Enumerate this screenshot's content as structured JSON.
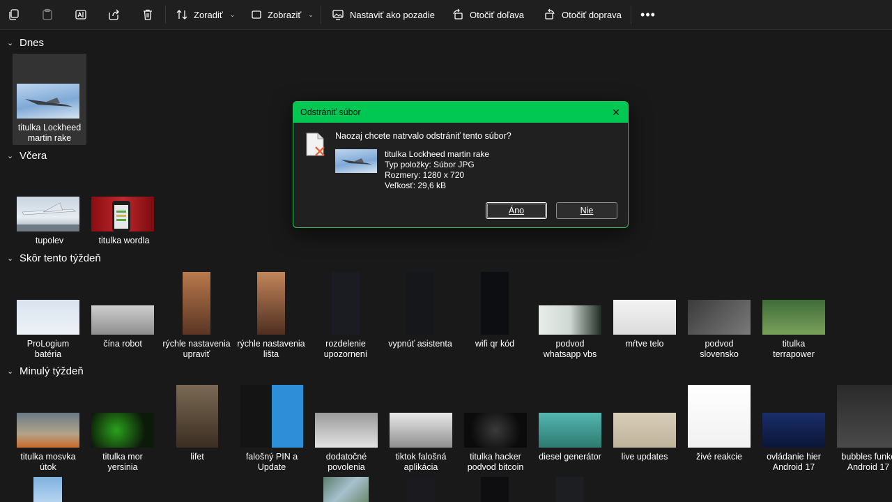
{
  "toolbar": {
    "sort_label": "Zoradiť",
    "view_label": "Zobraziť",
    "set_bg_label": "Nastaviť ako pozadie",
    "rotate_left_label": "Otočiť doľava",
    "rotate_right_label": "Otočiť doprava",
    "icons": [
      "copy-icon",
      "paste-icon",
      "rename-icon",
      "share-icon",
      "delete-icon",
      "sort-icon",
      "view-icon",
      "wallpaper-icon",
      "rotate-left-icon",
      "rotate-right-icon",
      "more-icon"
    ]
  },
  "groups": {
    "today": "Dnes",
    "yesterday": "Včera",
    "earlier_week": "Skôr tento týždeň",
    "last_week": "Minulý týždeň"
  },
  "items": {
    "today": [
      {
        "l1": "titulka Lockheed",
        "l2": "martin rake"
      }
    ],
    "yesterday": [
      {
        "l1": "tupolev",
        "l2": ""
      },
      {
        "l1": "titulka wordla",
        "l2": ""
      }
    ],
    "earlier": [
      {
        "l1": "ProLogium",
        "l2": "batéria"
      },
      {
        "l1": "čína robot",
        "l2": ""
      },
      {
        "l1": "rýchle nastavenia",
        "l2": "upraviť"
      },
      {
        "l1": "rýchle nastavenia",
        "l2": "lišta"
      },
      {
        "l1": "rozdelenie",
        "l2": "upozornení"
      },
      {
        "l1": "vypnúť asistenta",
        "l2": ""
      },
      {
        "l1": "wifi qr kód",
        "l2": ""
      },
      {
        "l1": "podvod",
        "l2": "whatsapp vbs"
      },
      {
        "l1": "mŕtve telo",
        "l2": ""
      },
      {
        "l1": "podvod",
        "l2": "slovensko"
      },
      {
        "l1": "titulka",
        "l2": "terrapower"
      }
    ],
    "last": [
      {
        "l1": "titulka mosvka",
        "l2": "útok"
      },
      {
        "l1": "titulka mor",
        "l2": "yersinia"
      },
      {
        "l1": "lifet",
        "l2": ""
      },
      {
        "l1": "falošný PIN a",
        "l2": "Update"
      },
      {
        "l1": "dodatočné",
        "l2": "povolenia"
      },
      {
        "l1": "tiktok falošná",
        "l2": "aplikácia"
      },
      {
        "l1": "titulka hacker",
        "l2": "podvod bitcoin"
      },
      {
        "l1": "diesel generátor",
        "l2": ""
      },
      {
        "l1": "live updates",
        "l2": ""
      },
      {
        "l1": "živé reakcie",
        "l2": ""
      },
      {
        "l1": "ovládanie hier",
        "l2": "Android 17"
      },
      {
        "l1": "bubbles funkc",
        "l2": "Android 17"
      }
    ]
  },
  "dialog": {
    "title": "Odstrániť súbor",
    "question": "Naozaj chcete natrvalo odstrániť tento súbor?",
    "file_name": "titulka Lockheed martin rake",
    "file_type": "Typ položky: Súbor JPG",
    "dimensions": "Rozmery: 1280 x 720",
    "size": "Veľkosť: 29,6 kB",
    "yes": "Áno",
    "no": "Nie"
  },
  "colors": {
    "accent": "#00c853",
    "background": "#191919",
    "toolbar": "#1f1f1f"
  }
}
